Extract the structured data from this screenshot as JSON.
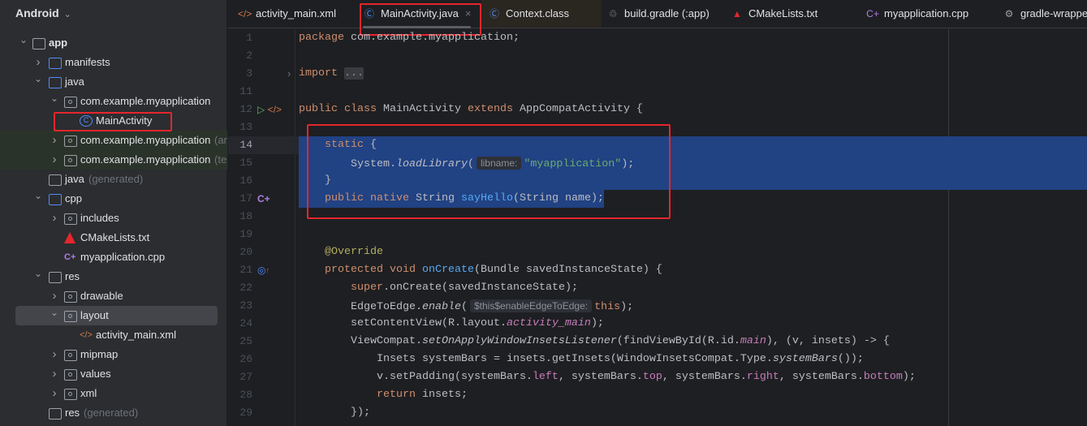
{
  "sidebar": {
    "title": "Android",
    "items": [
      {
        "label": "app",
        "level": 0,
        "arrow": "open",
        "icon": "module-icon"
      },
      {
        "label": "manifests",
        "level": 1,
        "arrow": "closed",
        "icon": "folder-icon"
      },
      {
        "label": "java",
        "level": 1,
        "arrow": "open",
        "icon": "folder-icon"
      },
      {
        "label": "com.example.myapplication",
        "level": 2,
        "arrow": "open",
        "icon": "package-icon"
      },
      {
        "label": "MainActivity",
        "level": 3,
        "arrow": "none",
        "icon": "class-icon"
      },
      {
        "label": "com.example.myapplication",
        "suffix": "(androidTest)",
        "level": 2,
        "arrow": "closed",
        "icon": "package-icon",
        "test": true
      },
      {
        "label": "com.example.myapplication",
        "suffix": "(test)",
        "level": 2,
        "arrow": "closed",
        "icon": "package-icon",
        "test": true
      },
      {
        "label": "java",
        "suffix": "(generated)",
        "level": 1,
        "arrow": "none",
        "icon": "generated-folder-icon"
      },
      {
        "label": "cpp",
        "level": 1,
        "arrow": "open",
        "icon": "folder-icon"
      },
      {
        "label": "includes",
        "level": 2,
        "arrow": "closed",
        "icon": "package-icon"
      },
      {
        "label": "CMakeLists.txt",
        "level": 2,
        "arrow": "none",
        "icon": "cmake-icon"
      },
      {
        "label": "myapplication.cpp",
        "level": 2,
        "arrow": "none",
        "icon": "cpp-icon"
      },
      {
        "label": "res",
        "level": 1,
        "arrow": "open",
        "icon": "res-folder-icon"
      },
      {
        "label": "drawable",
        "level": 2,
        "arrow": "closed",
        "icon": "package-icon"
      },
      {
        "label": "layout",
        "level": 2,
        "arrow": "open",
        "icon": "package-icon",
        "selected": true
      },
      {
        "label": "activity_main.xml",
        "level": 3,
        "arrow": "none",
        "icon": "xml-icon"
      },
      {
        "label": "mipmap",
        "level": 2,
        "arrow": "closed",
        "icon": "package-icon"
      },
      {
        "label": "values",
        "level": 2,
        "arrow": "closed",
        "icon": "package-icon"
      },
      {
        "label": "xml",
        "level": 2,
        "arrow": "closed",
        "icon": "package-icon"
      },
      {
        "label": "res",
        "suffix": "(generated)",
        "level": 1,
        "arrow": "none",
        "icon": "res-folder-icon"
      }
    ]
  },
  "tabs": [
    {
      "label": "activity_main.xml",
      "icon": "xml-icon"
    },
    {
      "label": "MainActivity.java",
      "icon": "class-icon",
      "active": true
    },
    {
      "label": "Context.class",
      "icon": "class-icon"
    },
    {
      "label": "build.gradle (:app)",
      "icon": "gradle-icon"
    },
    {
      "label": "CMakeLists.txt",
      "icon": "cmake-icon"
    },
    {
      "label": "myapplication.cpp",
      "icon": "cpp-icon"
    },
    {
      "label": "gradle-wrapper.properties",
      "icon": "gear-icon"
    }
  ],
  "colors": {
    "accent": "#548AF7",
    "selection": "#214283",
    "highlight_box": "#E5262C"
  },
  "editor": {
    "current_line": "14",
    "lines": [
      {
        "n": "1",
        "t": [
          [
            "kw",
            "package "
          ],
          [
            "",
            "com.example.myapplication;"
          ]
        ]
      },
      {
        "n": "2",
        "t": []
      },
      {
        "n": "3",
        "fold": true,
        "t": [
          [
            "kw",
            "import "
          ],
          [
            "fold",
            "..."
          ]
        ]
      },
      {
        "n": "11",
        "t": []
      },
      {
        "n": "12",
        "gutter": "run-icon",
        "t": [
          [
            "kw",
            "public class "
          ],
          [
            "",
            "MainActivity "
          ],
          [
            "kw",
            "extends "
          ],
          [
            "",
            "AppCompatActivity {"
          ]
        ]
      },
      {
        "n": "13",
        "t": []
      },
      {
        "n": "14",
        "t": [
          [
            "",
            "    "
          ],
          [
            "kw",
            "static "
          ],
          [
            "",
            "{"
          ]
        ]
      },
      {
        "n": "15",
        "t": [
          [
            "",
            "        System."
          ],
          [
            "it",
            "loadLibrary"
          ],
          [
            "",
            "("
          ],
          [
            "hint",
            "libname:"
          ],
          [
            "str",
            "\"myapplication\""
          ],
          [
            "",
            ");"
          ]
        ]
      },
      {
        "n": "16",
        "t": [
          [
            "",
            "    }"
          ]
        ]
      },
      {
        "n": "17",
        "gutter": "native-icon",
        "t": [
          [
            "",
            "    "
          ],
          [
            "kw",
            "public native "
          ],
          [
            "",
            "String "
          ],
          [
            "fn",
            "sayHello"
          ],
          [
            "",
            "(String name);"
          ]
        ]
      },
      {
        "n": "18",
        "t": []
      },
      {
        "n": "19",
        "t": []
      },
      {
        "n": "20",
        "t": [
          [
            "",
            "    "
          ],
          [
            "ann",
            "@Override"
          ]
        ]
      },
      {
        "n": "21",
        "gutter": "override-icon",
        "t": [
          [
            "",
            "    "
          ],
          [
            "kw",
            "protected void "
          ],
          [
            "fn",
            "onCreate"
          ],
          [
            "",
            "(Bundle savedInstanceState) {"
          ]
        ]
      },
      {
        "n": "22",
        "t": [
          [
            "",
            "        "
          ],
          [
            "kw",
            "super"
          ],
          [
            "",
            ".onCreate(savedInstanceState);"
          ]
        ]
      },
      {
        "n": "23",
        "t": [
          [
            "",
            "        EdgeToEdge."
          ],
          [
            "it",
            "enable"
          ],
          [
            "",
            "("
          ],
          [
            "hint",
            "$this$enableEdgeToEdge:"
          ],
          [
            "kw",
            "this"
          ],
          [
            "",
            ");"
          ]
        ]
      },
      {
        "n": "24",
        "t": [
          [
            "",
            "        setContentView(R.layout."
          ],
          [
            "fld it",
            "activity_main"
          ],
          [
            "",
            ");"
          ]
        ]
      },
      {
        "n": "25",
        "t": [
          [
            "",
            "        ViewCompat."
          ],
          [
            "it",
            "setOnApplyWindowInsetsListener"
          ],
          [
            "",
            "(findViewById(R.id."
          ],
          [
            "fld it",
            "main"
          ],
          [
            "",
            "), (v, insets) -> {"
          ]
        ]
      },
      {
        "n": "26",
        "t": [
          [
            "",
            "            Insets systemBars = insets.getInsets(WindowInsetsCompat.Type."
          ],
          [
            "it",
            "systemBars"
          ],
          [
            "",
            "());"
          ]
        ]
      },
      {
        "n": "27",
        "t": [
          [
            "",
            "            v.setPadding(systemBars."
          ],
          [
            "fld",
            "left"
          ],
          [
            "",
            ", systemBars."
          ],
          [
            "fld",
            "top"
          ],
          [
            "",
            ", systemBars."
          ],
          [
            "fld",
            "right"
          ],
          [
            "",
            ", systemBars."
          ],
          [
            "fld",
            "bottom"
          ],
          [
            "",
            ");"
          ]
        ]
      },
      {
        "n": "28",
        "t": [
          [
            "",
            "            "
          ],
          [
            "kw",
            "return "
          ],
          [
            "",
            "insets;"
          ]
        ]
      },
      {
        "n": "29",
        "t": [
          [
            "",
            "        });"
          ]
        ]
      }
    ]
  }
}
